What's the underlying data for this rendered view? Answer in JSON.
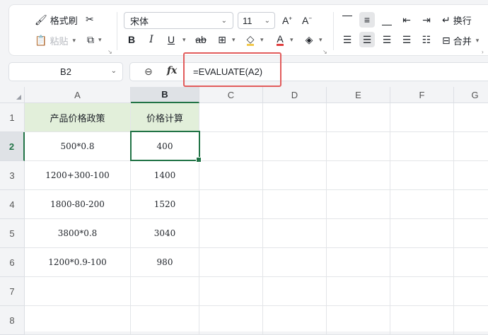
{
  "ribbon": {
    "format_painter": "格式刷",
    "paste": "粘贴",
    "font_name": "宋体",
    "font_size": "11",
    "wrap_text": "换行",
    "merge": "合并"
  },
  "formula_bar": {
    "name_box": "B2",
    "fx_label": "fx",
    "formula": "=EVALUATE(A2)"
  },
  "sheet": {
    "columns": [
      "A",
      "B",
      "C",
      "D",
      "E",
      "F",
      "G"
    ],
    "rows": [
      "1",
      "2",
      "3",
      "4",
      "5",
      "6",
      "7",
      "8"
    ],
    "header": {
      "a1": "产品价格政策",
      "b1": "价格计算"
    },
    "data": [
      {
        "a": "500*0.8",
        "b": "400"
      },
      {
        "a": "1200+300-100",
        "b": "1400"
      },
      {
        "a": "1800-80-200",
        "b": "1520"
      },
      {
        "a": "3800*0.8",
        "b": "3040"
      },
      {
        "a": "1200*0.9-100",
        "b": "980"
      }
    ],
    "selected_cell": "B2"
  },
  "colors": {
    "header_fill": "#e2efda",
    "selection": "#217346",
    "highlight_box": "#e25c5c"
  }
}
